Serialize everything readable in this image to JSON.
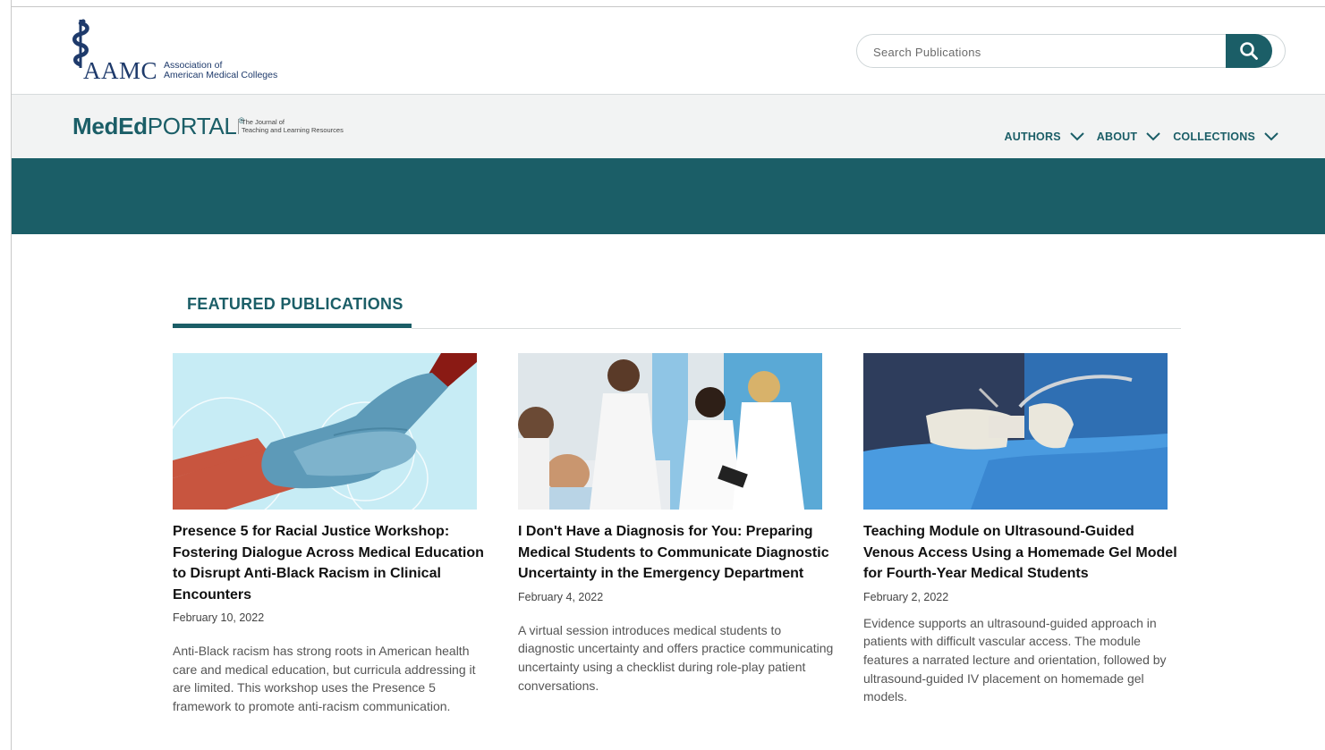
{
  "header": {
    "logo_wordmark": "AAMC",
    "logo_subtitle_line1": "Association of",
    "logo_subtitle_line2": "American Medical Colleges",
    "search_placeholder": "Search Publications",
    "search_icon": "search-icon"
  },
  "subheader": {
    "brand_bold": "MedEd",
    "brand_light": "PORTAL",
    "brand_reg": "®",
    "tagline_line1": "The Journal of",
    "tagline_line2": "Teaching and Learning Resources",
    "nav": [
      {
        "label": "AUTHORS",
        "icon": "chevron-down-icon"
      },
      {
        "label": "ABOUT",
        "icon": "chevron-down-icon"
      },
      {
        "label": "COLLECTIONS",
        "icon": "chevron-down-icon"
      }
    ]
  },
  "colors": {
    "brand_teal": "#1b5e67",
    "navy": "#1e3a6b",
    "subheader_bg": "#f2f3f3"
  },
  "featured": {
    "heading": "FEATURED PUBLICATIONS",
    "cards": [
      {
        "title": "Presence 5 for Racial Justice Workshop: Fostering Dialogue Across Medical Education to Disrupt Anti-Black Racism in Clinical Encounters",
        "date": "February 10, 2022",
        "description": "Anti-Black racism has strong roots in American health care and medical education, but curricula addressing it are limited. This workshop uses the Presence 5 framework to promote anti-racism communication."
      },
      {
        "title": "I Don't Have a Diagnosis for You: Preparing Medical Students to Communicate Diagnostic Uncertainty in the Emergency Department",
        "date": "February 4, 2022",
        "description": "A virtual session introduces medical students to diagnostic uncertainty and offers practice communicating uncertainty using a checklist during role-play patient conversations."
      },
      {
        "title": "Teaching Module on Ultrasound-Guided Venous Access Using a Homemade Gel Model for Fourth-Year Medical Students",
        "date": "February 2, 2022",
        "description": "Evidence supports an ultrasound-guided approach in patients with difficult vascular access. The module features a narrated lecture and orientation, followed by ultrasound-guided IV placement on homemade gel models."
      }
    ]
  }
}
